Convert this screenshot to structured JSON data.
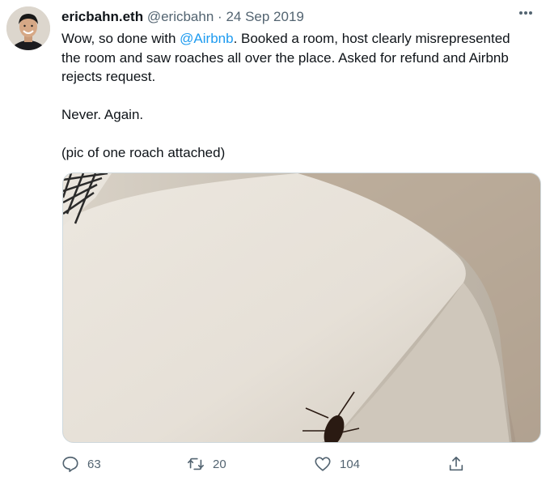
{
  "tweet": {
    "name": "ericbahn.eth",
    "handle": "@ericbahn",
    "separator": "·",
    "date": "24 Sep 2019",
    "text_before_mention": "Wow, so done with ",
    "mention": "@Airbnb",
    "text_after_mention": ". Booked a room, host clearly misrepresented the room and saw roaches all over the place. Asked for refund and Airbnb rejects request.",
    "line2": "Never. Again.",
    "line3": "(pic of one roach attached)",
    "more_icon": "more-horizontal-icon"
  },
  "actions": {
    "reply_count": "63",
    "retweet_count": "20",
    "like_count": "104"
  },
  "colors": {
    "accent": "#1d9bf0",
    "secondary_text": "#536471",
    "primary_text": "#0f1419"
  }
}
